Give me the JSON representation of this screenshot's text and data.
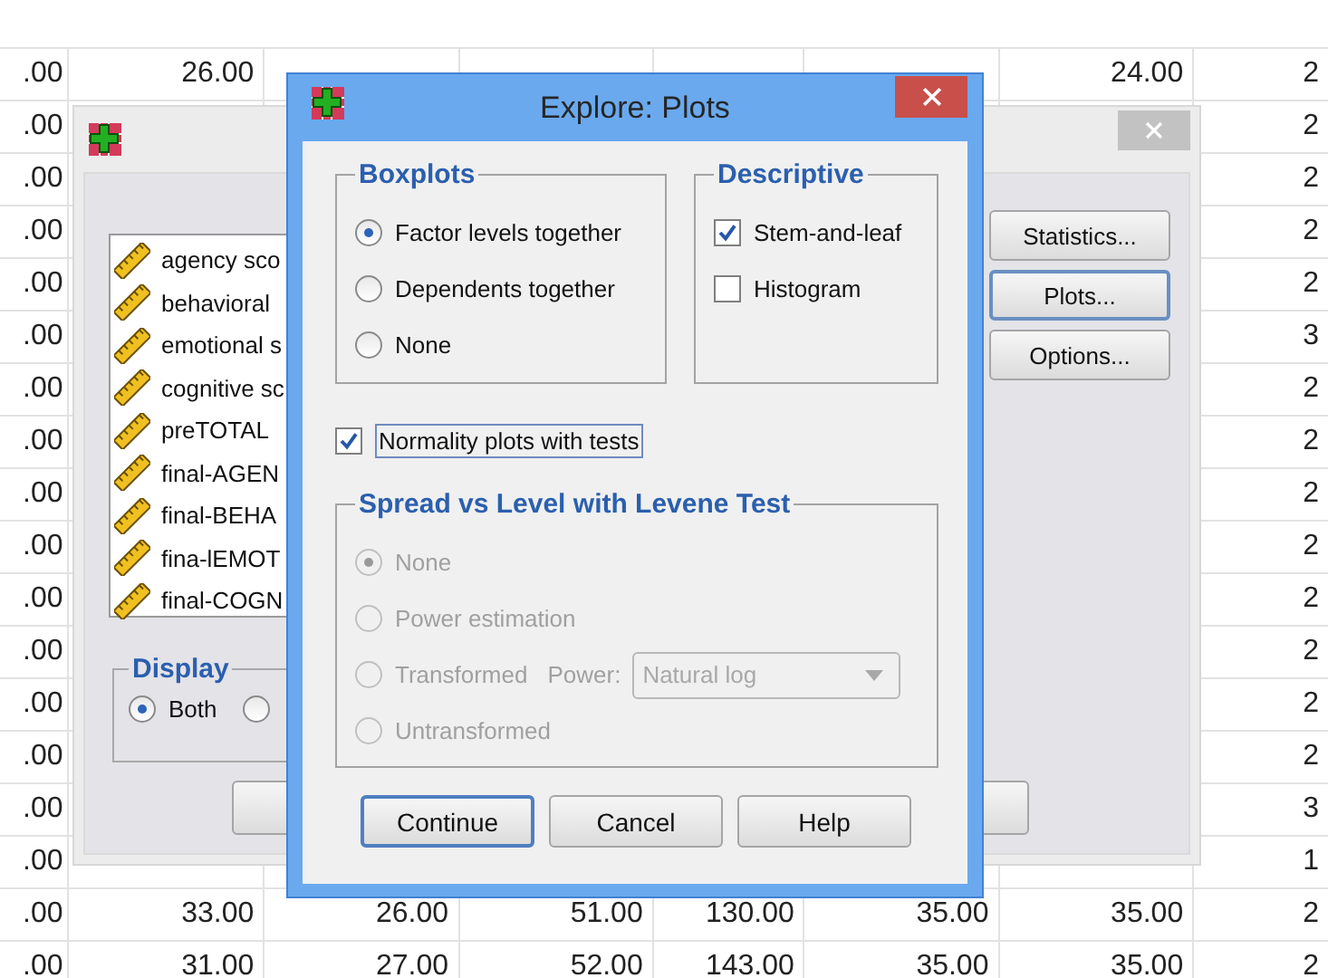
{
  "spreadsheet": {
    "rows": [
      {
        "cells": [
          ".00",
          "26.00",
          null,
          null,
          null,
          null,
          "24.00",
          "2"
        ]
      },
      {
        "cells": [
          ".00",
          null,
          null,
          null,
          null,
          null,
          null,
          "2"
        ]
      },
      {
        "cells": [
          ".00",
          null,
          null,
          null,
          null,
          null,
          null,
          "2"
        ]
      },
      {
        "cells": [
          ".00",
          null,
          null,
          null,
          null,
          null,
          null,
          "2"
        ]
      },
      {
        "cells": [
          ".00",
          null,
          null,
          null,
          null,
          null,
          null,
          "2"
        ]
      },
      {
        "cells": [
          ".00",
          null,
          null,
          null,
          null,
          null,
          null,
          "3"
        ]
      },
      {
        "cells": [
          ".00",
          null,
          null,
          null,
          null,
          null,
          null,
          "2"
        ]
      },
      {
        "cells": [
          ".00",
          null,
          null,
          null,
          null,
          null,
          null,
          "2"
        ]
      },
      {
        "cells": [
          ".00",
          null,
          null,
          null,
          null,
          null,
          null,
          "2"
        ]
      },
      {
        "cells": [
          ".00",
          null,
          null,
          null,
          null,
          null,
          null,
          "2"
        ]
      },
      {
        "cells": [
          ".00",
          null,
          null,
          null,
          null,
          null,
          null,
          "2"
        ]
      },
      {
        "cells": [
          ".00",
          null,
          null,
          null,
          null,
          null,
          null,
          "2"
        ]
      },
      {
        "cells": [
          ".00",
          null,
          null,
          null,
          null,
          null,
          null,
          "2"
        ]
      },
      {
        "cells": [
          ".00",
          null,
          null,
          null,
          null,
          null,
          null,
          "2"
        ]
      },
      {
        "cells": [
          ".00",
          null,
          null,
          null,
          null,
          null,
          null,
          "3"
        ]
      },
      {
        "cells": [
          ".00",
          null,
          null,
          null,
          null,
          null,
          null,
          "1"
        ]
      },
      {
        "cells": [
          ".00",
          "33.00",
          "26.00",
          "51.00",
          "130.00",
          "35.00",
          "35.00",
          "2"
        ]
      },
      {
        "cells": [
          ".00",
          "31.00",
          "27.00",
          "52.00",
          "143.00",
          "35.00",
          "35.00",
          "2"
        ]
      }
    ]
  },
  "explore_dialog": {
    "variables": [
      "agency sco",
      "behavioral",
      "emotional s",
      "cognitive sc",
      "preTOTAL",
      "final-AGEN",
      "final-BEHA",
      "fina-lEMOT",
      "final-COGN"
    ],
    "display": {
      "legend": "Display",
      "options": [
        {
          "label": "Both",
          "selected": true
        },
        {
          "selected": false
        }
      ]
    },
    "buttons": [
      {
        "label": "Statistics...",
        "focused": false
      },
      {
        "label": "Plots...",
        "focused": true
      },
      {
        "label": "Options...",
        "focused": false
      }
    ]
  },
  "plots_dialog": {
    "title": "Explore: Plots",
    "boxplots": {
      "legend": "Boxplots",
      "options": [
        {
          "label": "Factor levels together",
          "selected": true
        },
        {
          "label": "Dependents together",
          "selected": false
        },
        {
          "label": "None",
          "selected": false
        }
      ]
    },
    "descriptive": {
      "legend": "Descriptive",
      "options": [
        {
          "label": "Stem-and-leaf",
          "checked": true
        },
        {
          "label": "Histogram",
          "checked": false
        }
      ]
    },
    "normality": {
      "label": "Normality plots with tests",
      "checked": true
    },
    "spread": {
      "legend": "Spread vs Level with Levene Test",
      "disabled": true,
      "options": [
        {
          "label": "None",
          "selected": true
        },
        {
          "label": "Power estimation",
          "selected": false
        },
        {
          "label": "Transformed",
          "selected": false,
          "power": {
            "label": "Power:",
            "value": "Natural log"
          }
        },
        {
          "label": "Untransformed",
          "selected": false
        }
      ]
    },
    "buttons": [
      {
        "label": "Continue",
        "default": true
      },
      {
        "label": "Cancel",
        "default": false
      },
      {
        "label": "Help",
        "default": false
      }
    ]
  }
}
